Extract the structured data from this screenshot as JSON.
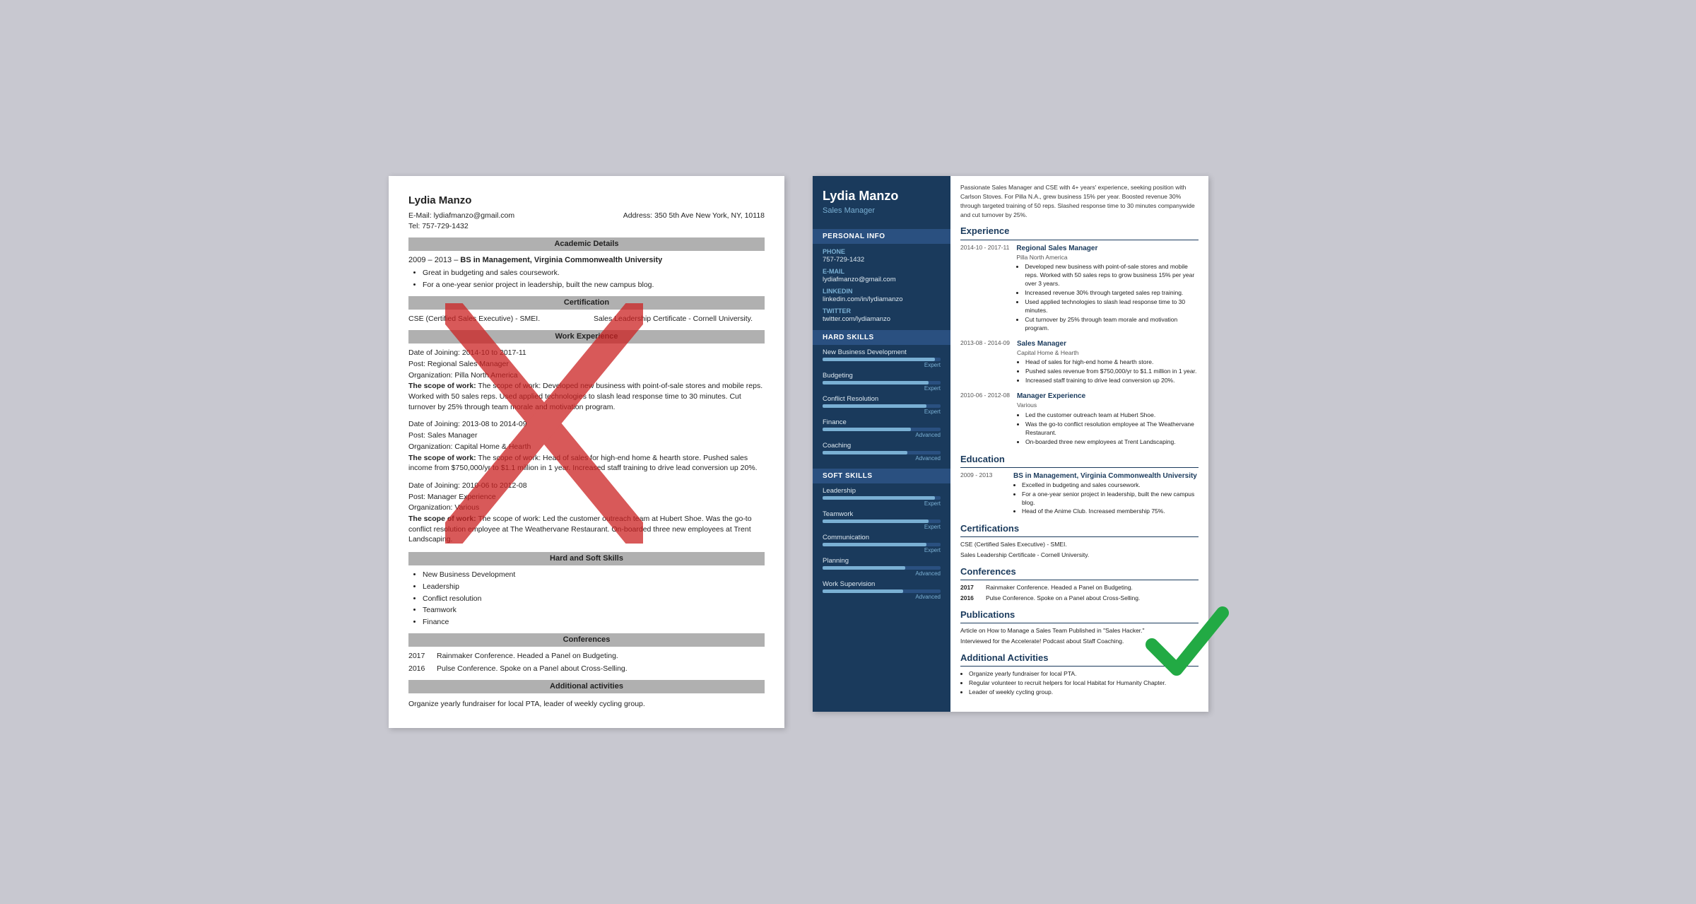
{
  "left": {
    "name": "Lydia Manzo",
    "email_label": "E-Mail:",
    "email": "lydiafmanzo@gmail.com",
    "address_label": "Address:",
    "address": "350 5th Ave New York, NY, 10118",
    "tel_label": "Tel:",
    "tel": "757-729-1432",
    "sections": {
      "academic": "Academic Details",
      "certification": "Certification",
      "work": "Work Experience",
      "skills": "Hard and Soft Skills",
      "conferences": "Conferences",
      "activities": "Additional activities"
    },
    "education": {
      "dates": "2009 – 2013",
      "degree": "BS in Management, Virginia Commonwealth University",
      "bullets": [
        "Great in budgeting and sales coursework.",
        "For a one-year senior project in leadership, built the new campus blog."
      ]
    },
    "certifications": [
      "CSE (Certified Sales Executive) - SMEI.",
      "Sales Leadership Certificate - Cornell University."
    ],
    "work": [
      {
        "dates": "Date of Joining: 2014-10 to 2017-11",
        "post": "Post: Regional Sales Manager",
        "org": "Organization: Pilla North America",
        "scope": "The scope of work: Developed new business with point-of-sale stores and mobile reps. Worked with 50 sales reps. Used applied technologies to slash lead response time to 30 minutes. Cut turnover by 25% through team morale and motivation program."
      },
      {
        "dates": "Date of Joining: 2013-08 to 2014-09",
        "post": "Post: Sales Manager",
        "org": "Organization: Capital Home & Hearth",
        "scope": "The scope of work: Head of sales for high-end home & hearth store. Pushed sales income from $750,000/yr to $1.1 million in 1 year. Increased staff training to drive lead conversion up 20%."
      },
      {
        "dates": "Date of Joining: 2010-06 to 2012-08",
        "post": "Post: Manager Experience",
        "org": "Organization: Various",
        "scope": "The scope of work: Led the customer outreach team at Hubert Shoe. Was the go-to conflict resolution employee at The Weathervane Restaurant. On-boarded three new employees at Trent Landscaping."
      }
    ],
    "skills": [
      "New Business Development",
      "Leadership",
      "Conflict resolution",
      "Teamwork",
      "Finance"
    ],
    "conferences": [
      {
        "year": "2017",
        "text": "Rainmaker Conference. Headed a Panel on Budgeting."
      },
      {
        "year": "2016",
        "text": "Pulse Conference. Spoke on a Panel about Cross-Selling."
      }
    ],
    "activities": "Organize yearly fundraiser for local PTA, leader of weekly cycling group."
  },
  "right": {
    "name": "Lydia Manzo",
    "title": "Sales Manager",
    "summary": "Passionate Sales Manager and CSE with 4+ years' experience, seeking position with Carlson Stoves. For Pilla N.A., grew business 15% per year. Boosted revenue 30% through targeted training of 50 reps. Slashed response time to 30 minutes companywide and cut turnover by 25%.",
    "personal_info": {
      "section_title": "Personal Info",
      "phone_label": "Phone",
      "phone": "757-729-1432",
      "email_label": "E-mail",
      "email": "lydiafmanzo@gmail.com",
      "linkedin_label": "LinkedIn",
      "linkedin": "linkedin.com/in/lydiamanzo",
      "twitter_label": "Twitter",
      "twitter": "twitter.com/lydiamanzo"
    },
    "hard_skills": {
      "section_title": "Hard Skills",
      "skills": [
        {
          "name": "New Business Development",
          "pct": 95,
          "level": "Expert"
        },
        {
          "name": "Budgeting",
          "pct": 90,
          "level": "Expert"
        },
        {
          "name": "Conflict Resolution",
          "pct": 88,
          "level": "Expert"
        },
        {
          "name": "Finance",
          "pct": 75,
          "level": "Advanced"
        },
        {
          "name": "Coaching",
          "pct": 72,
          "level": "Advanced"
        }
      ]
    },
    "soft_skills": {
      "section_title": "Soft Skills",
      "skills": [
        {
          "name": "Leadership",
          "pct": 95,
          "level": "Expert"
        },
        {
          "name": "Teamwork",
          "pct": 90,
          "level": "Expert"
        },
        {
          "name": "Communication",
          "pct": 88,
          "level": "Expert"
        },
        {
          "name": "Planning",
          "pct": 70,
          "level": "Advanced"
        },
        {
          "name": "Work Supervision",
          "pct": 68,
          "level": "Advanced"
        }
      ]
    },
    "sections": {
      "experience": "Experience",
      "education": "Education",
      "certifications": "Certifications",
      "conferences": "Conferences",
      "publications": "Publications",
      "activities": "Additional Activities"
    },
    "experience": [
      {
        "dates": "2014-10 -\n2017-11",
        "title": "Regional Sales Manager",
        "company": "Pilla North America",
        "bullets": [
          "Developed new business with point-of-sale stores and mobile reps. Worked with 50 sales reps to grow business 15% per year over 3 years.",
          "Increased revenue 30% through targeted sales rep training.",
          "Used applied technologies to slash lead response time to 30 minutes.",
          "Cut turnover by 25% through team morale and motivation program."
        ]
      },
      {
        "dates": "2013-08 -\n2014-09",
        "title": "Sales Manager",
        "company": "Capital Home & Hearth",
        "bullets": [
          "Head of sales for high-end home & hearth store.",
          "Pushed sales revenue from $750,000/yr to $1.1 million in 1 year.",
          "Increased staff training to drive lead conversion up 20%."
        ]
      },
      {
        "dates": "2010-06 -\n2012-08",
        "title": "Manager Experience",
        "company": "Various",
        "bullets": [
          "Led the customer outreach team at Hubert Shoe.",
          "Was the go-to conflict resolution employee at The Weathervane Restaurant.",
          "On-boarded three new employees at Trent Landscaping."
        ]
      }
    ],
    "education": [
      {
        "dates": "2009 -\n2013",
        "title": "BS in Management, Virginia Commonwealth University",
        "bullets": [
          "Excelled in budgeting and sales coursework.",
          "For a one-year senior project in leadership, built the new campus blog.",
          "Head of the Anime Club. Increased membership 75%."
        ]
      }
    ],
    "certifications": [
      "CSE (Certified Sales Executive) - SMEI.",
      "Sales Leadership Certificate - Cornell University."
    ],
    "conferences": [
      {
        "year": "2017",
        "text": "Rainmaker Conference. Headed a Panel on Budgeting."
      },
      {
        "year": "2016",
        "text": "Pulse Conference. Spoke on a Panel about Cross-Selling."
      }
    ],
    "publications": [
      "Article on How to Manage a Sales Team Published in \"Sales Hacker.\"",
      "Interviewed for the Accelerate! Podcast about Staff Coaching."
    ],
    "activities": [
      "Organize yearly fundraiser for local PTA.",
      "Regular volunteer to recruit helpers for local Habitat for Humanity Chapter.",
      "Leader of weekly cycling group."
    ]
  }
}
